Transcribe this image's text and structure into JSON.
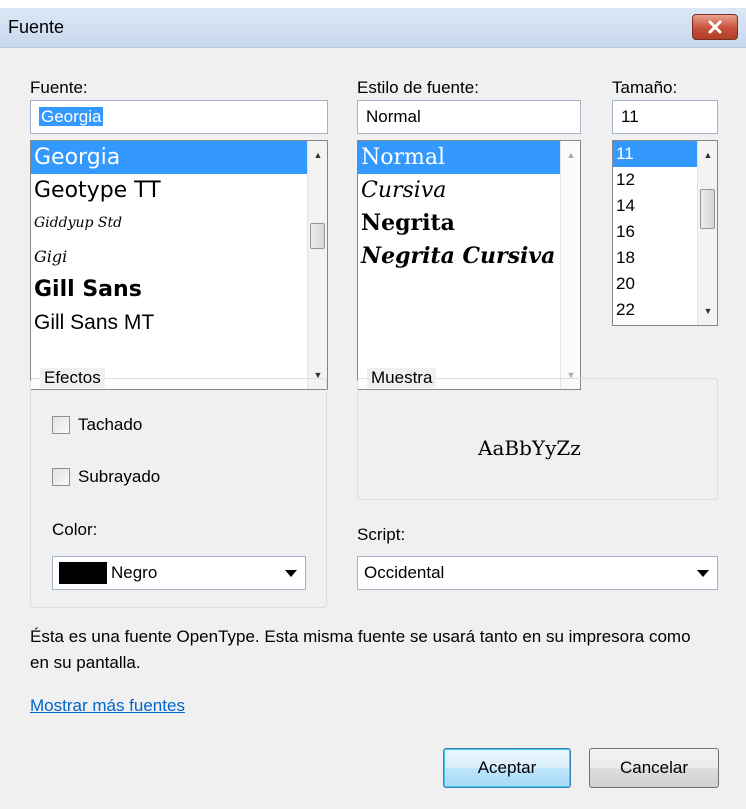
{
  "window": {
    "title": "Fuente"
  },
  "font": {
    "label": "Fuente:",
    "value": "Georgia",
    "items": [
      "Georgia",
      "Geotype TT",
      "Giddyup Std",
      "Gigi",
      "Gill Sans",
      "Gill Sans MT"
    ],
    "selected": "Georgia"
  },
  "style": {
    "label": "Estilo de fuente:",
    "value": "Normal",
    "items": [
      "Normal",
      "Cursiva",
      "Negrita",
      "Negrita Cursiva"
    ],
    "selected": "Normal"
  },
  "size": {
    "label": "Tamaño:",
    "value": "11",
    "items": [
      "11",
      "12",
      "14",
      "16",
      "18",
      "20",
      "22"
    ],
    "selected": "11"
  },
  "effects": {
    "title": "Efectos",
    "strikethrough": {
      "label": "Tachado",
      "checked": false
    },
    "underline": {
      "label": "Subrayado",
      "checked": false
    },
    "color_label": "Color:",
    "color_value": "Negro",
    "color_hex": "#000000"
  },
  "sample": {
    "title": "Muestra",
    "text": "AaBbYyZz"
  },
  "script": {
    "label": "Script:",
    "value": "Occidental"
  },
  "description": "Ésta es una fuente OpenType. Esta misma fuente se usará tanto en su impresora como en su pantalla.",
  "more_fonts_link": "Mostrar más fuentes",
  "buttons": {
    "ok": "Aceptar",
    "cancel": "Cancelar"
  },
  "icons": {
    "close": "close-icon",
    "scroll_up": "scroll-up-arrow-icon",
    "scroll_down": "scroll-down-arrow-icon",
    "dropdown": "chevron-down-icon"
  }
}
